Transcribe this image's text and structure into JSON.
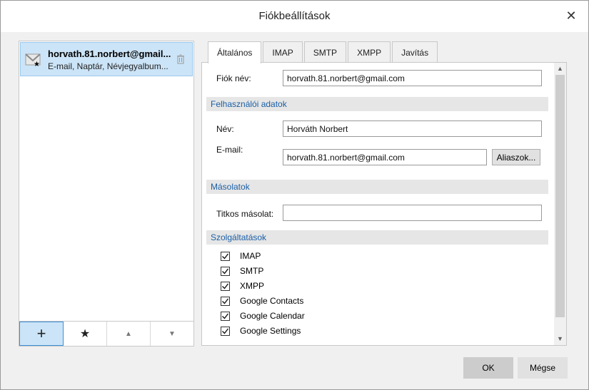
{
  "window": {
    "title": "Fiókbeállítások",
    "close_label": "✕"
  },
  "accounts": [
    {
      "name": "horvath.81.norbert@gmail...",
      "subtitle": "E-mail, Naptár, Névjegyalbum..."
    }
  ],
  "account_toolbar": {
    "add": "+",
    "favorite": "★",
    "move_up": "▲",
    "move_down": "▼"
  },
  "tabs": [
    {
      "label": "Általános",
      "selected": true
    },
    {
      "label": "IMAP"
    },
    {
      "label": "SMTP"
    },
    {
      "label": "XMPP"
    },
    {
      "label": "Javítás"
    }
  ],
  "general": {
    "account_name_label": "Fiók név:",
    "account_name_value": "horvath.81.norbert@gmail.com",
    "user_section": "Felhasználói adatok",
    "name_label": "Név:",
    "name_value": "Horváth Norbert",
    "email_label": "E-mail:",
    "email_value": "horvath.81.norbert@gmail.com",
    "aliases_button": "Aliaszok...",
    "copies_section": "Másolatok",
    "bcc_label": "Titkos másolat:",
    "bcc_value": "",
    "services_section": "Szolgáltatások",
    "services": [
      {
        "label": "IMAP",
        "checked": true
      },
      {
        "label": "SMTP",
        "checked": true
      },
      {
        "label": "XMPP",
        "checked": true
      },
      {
        "label": "Google Contacts",
        "checked": true
      },
      {
        "label": "Google Calendar",
        "checked": true
      },
      {
        "label": "Google Settings",
        "checked": true
      }
    ]
  },
  "footer": {
    "ok": "OK",
    "cancel": "Mégse"
  },
  "colors": {
    "accent": "#1b5fa6",
    "selection": "#cce4f7"
  }
}
